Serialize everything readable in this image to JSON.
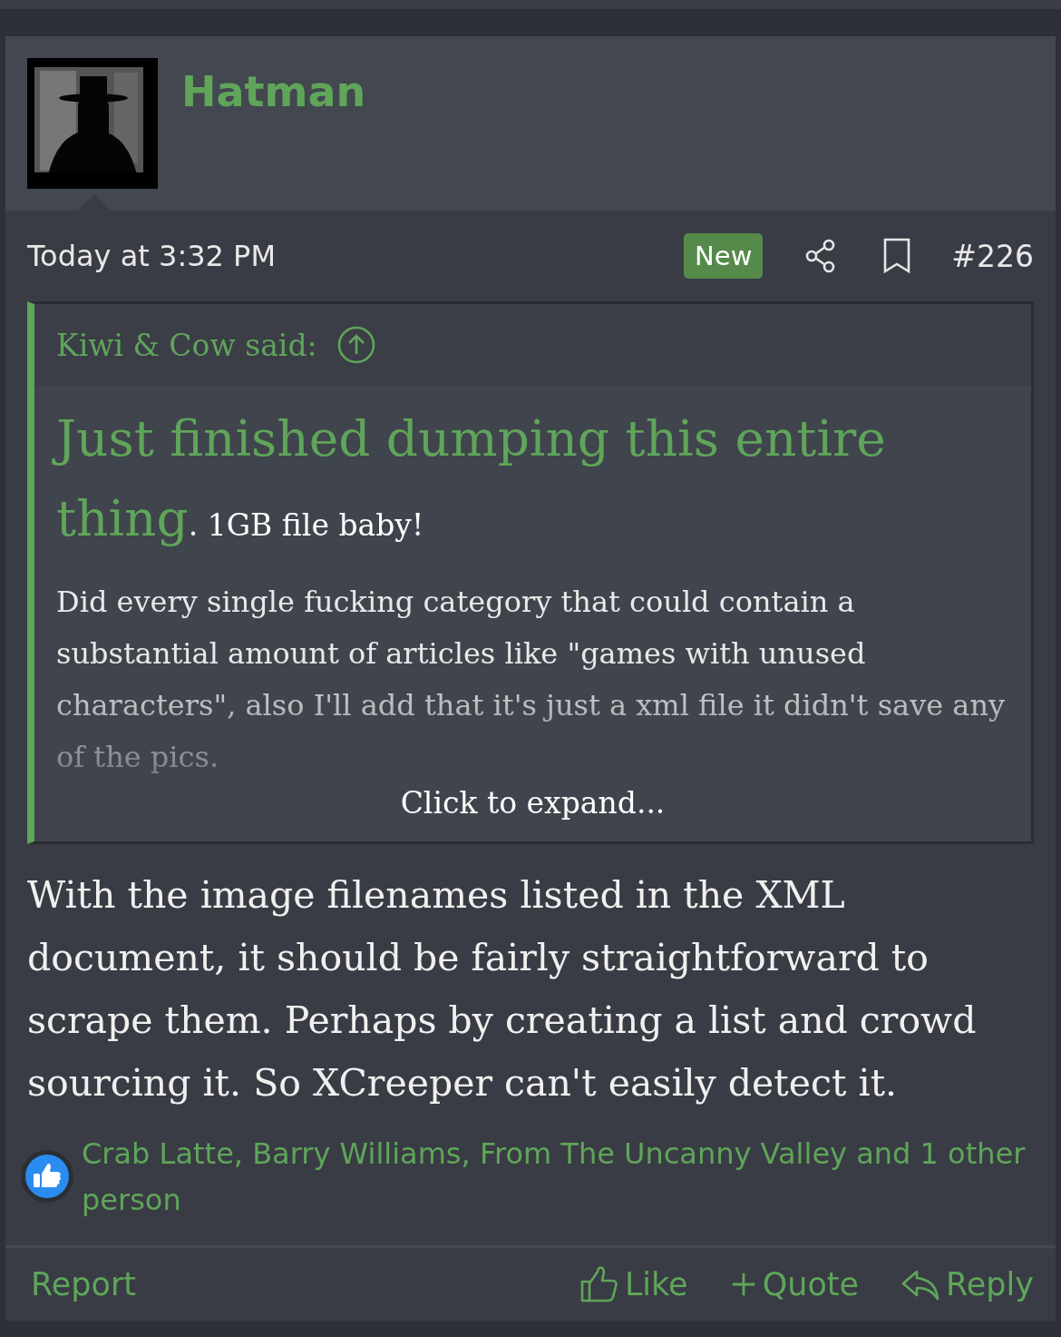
{
  "post": {
    "author": "Hatman",
    "date": "Today at 3:32 PM",
    "badge": "New",
    "number": "#226"
  },
  "quote": {
    "attribution": "Kiwi & Cow said:",
    "lead": "Just finished dumping this entire thing",
    "lead_rest": ". 1GB file baby!",
    "body": "Did every single fucking category that could contain a substantial amount of articles like \"games with unused characters\", also I'll add that it's just a xml file it didn't save any of the pics.",
    "expand": "Click to expand..."
  },
  "body": "With the image filenames listed in the XML document, it should be fairly straightforward to scrape them. Perhaps by creating a list and crowd sourcing it. So XCreeper can't easily detect it.",
  "reactions": {
    "text": "Crab Latte, Barry Williams, From The Uncanny Valley and 1 other person"
  },
  "actions": [
    {
      "kind": "report",
      "label": "Report"
    },
    {
      "kind": "like",
      "label": "Like"
    },
    {
      "kind": "quote",
      "label": "Quote"
    },
    {
      "kind": "reply",
      "label": "Reply"
    }
  ]
}
